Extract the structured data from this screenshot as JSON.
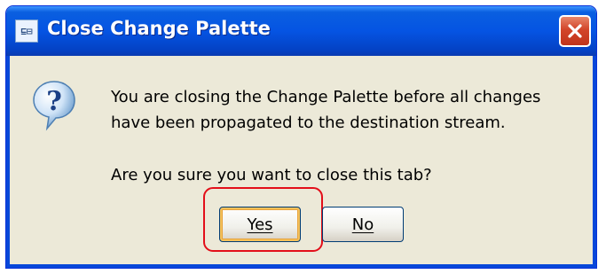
{
  "window": {
    "title": "Close Change Palette",
    "app_icon_text": "⊑⊟",
    "close_icon": "close-icon"
  },
  "dialog": {
    "icon": "question-icon",
    "message_line1": "You are closing the Change Palette before all changes have been propagated to the destination stream.",
    "message_line2": "Are you sure you want to close this tab?"
  },
  "buttons": {
    "yes_label": "Yes",
    "no_label": "No"
  },
  "colors": {
    "title_bar": "#0554e3",
    "dialog_bg": "#ece9d8",
    "close_button": "#d2452a",
    "highlight": "#e30f1a"
  }
}
